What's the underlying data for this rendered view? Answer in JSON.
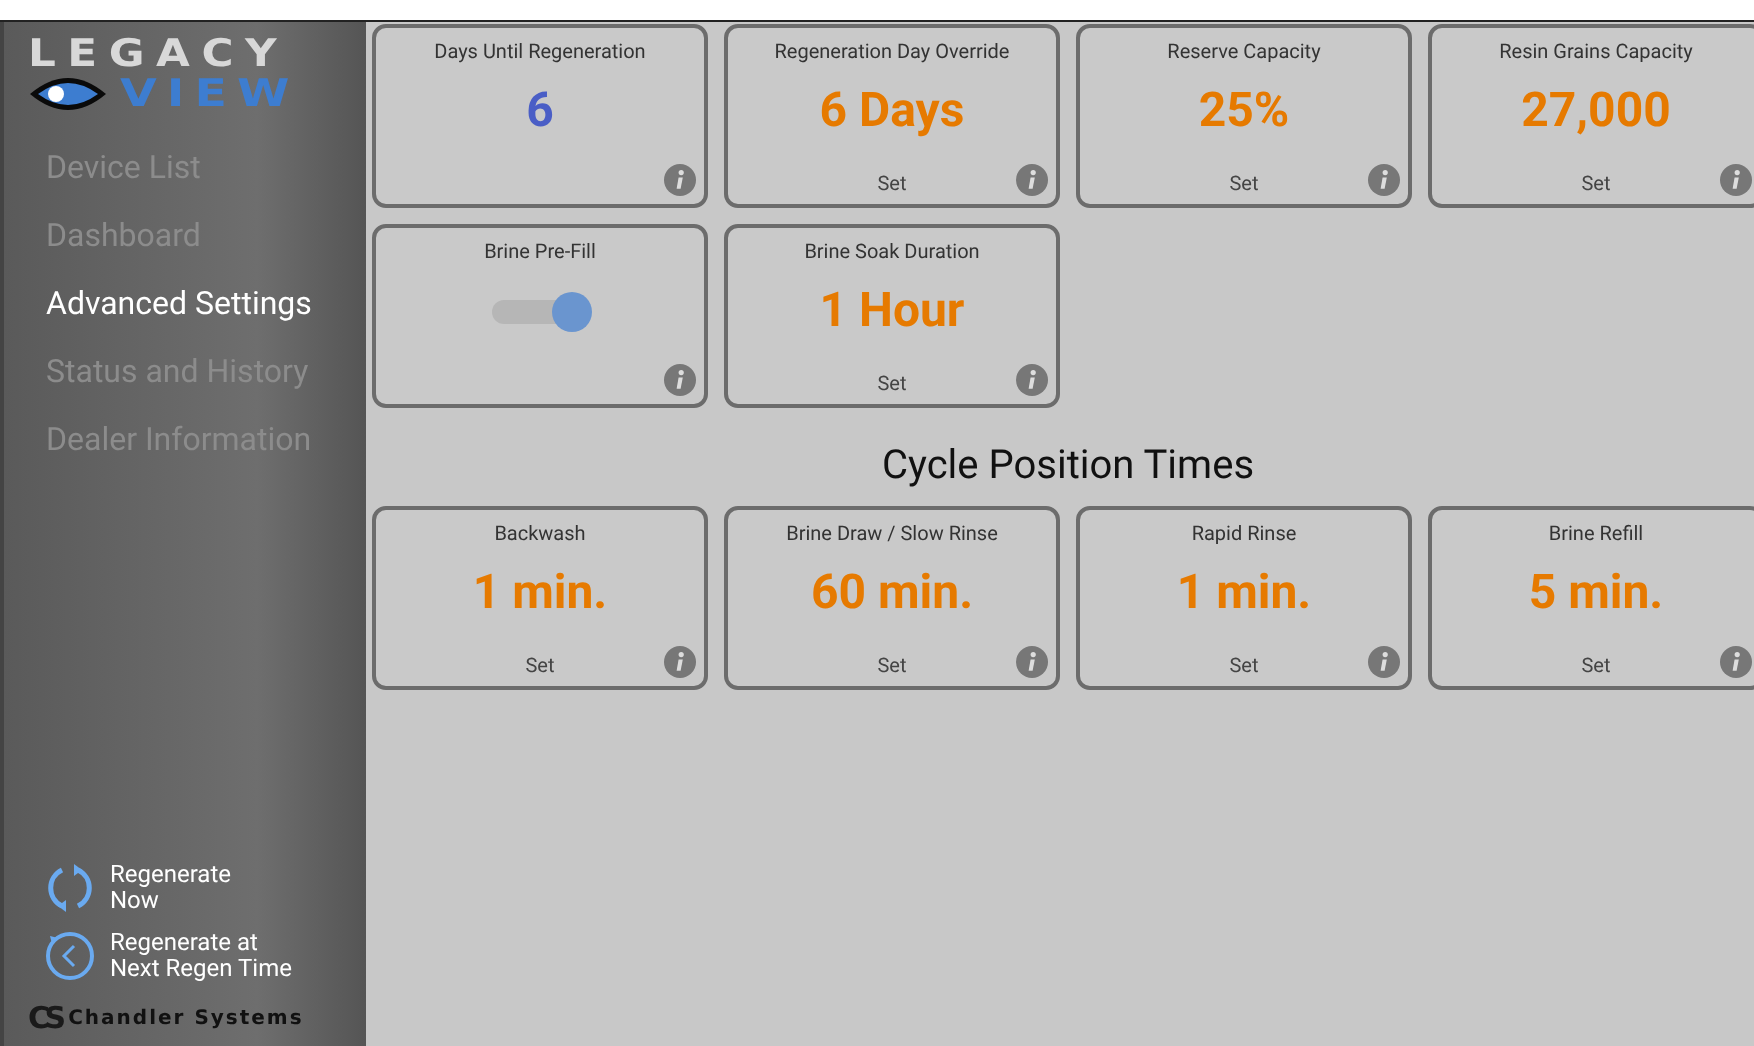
{
  "logo": {
    "top": "LEGACY",
    "bottom": "VIEW"
  },
  "nav": [
    {
      "label": "Device List",
      "selected": false
    },
    {
      "label": "Dashboard",
      "selected": false
    },
    {
      "label": "Advanced Settings",
      "selected": true
    },
    {
      "label": "Status and History",
      "selected": false
    },
    {
      "label": "Dealer Information",
      "selected": false
    }
  ],
  "actions": [
    {
      "kind": "now",
      "label": "Regenerate\nNow"
    },
    {
      "kind": "scheduled",
      "label": "Regenerate at\nNext Regen Time"
    }
  ],
  "brand": {
    "initials": "CS",
    "name": "Chandler Systems"
  },
  "settings": [
    {
      "kind": "value",
      "title": "Days Until Regeneration",
      "value": "6",
      "color": "#4a5ec6"
    },
    {
      "kind": "value",
      "title": "Regeneration Day Override",
      "value": "6 Days",
      "color": "#e67a00",
      "action": "Set"
    },
    {
      "kind": "value",
      "title": "Reserve Capacity",
      "value": "25%",
      "color": "#e67a00",
      "action": "Set"
    },
    {
      "kind": "value",
      "title": "Resin Grains Capacity",
      "value": "27,000",
      "color": "#e67a00",
      "action": "Set"
    },
    {
      "kind": "toggle",
      "title": "Brine Pre-Fill",
      "on": true
    },
    {
      "kind": "value",
      "title": "Brine Soak Duration",
      "value": "1 Hour",
      "color": "#e67a00",
      "action": "Set"
    }
  ],
  "cycle_section": {
    "heading": "Cycle Position Times",
    "cards": [
      {
        "kind": "value",
        "title": "Backwash",
        "value": "1 min.",
        "color": "#e67a00",
        "action": "Set"
      },
      {
        "kind": "value",
        "title": "Brine Draw / Slow Rinse",
        "value": "60 min.",
        "color": "#e67a00",
        "action": "Set"
      },
      {
        "kind": "value",
        "title": "Rapid Rinse",
        "value": "1 min.",
        "color": "#e67a00",
        "action": "Set"
      },
      {
        "kind": "value",
        "title": "Brine Refill",
        "value": "5 min.",
        "color": "#e67a00",
        "action": "Set"
      }
    ]
  }
}
